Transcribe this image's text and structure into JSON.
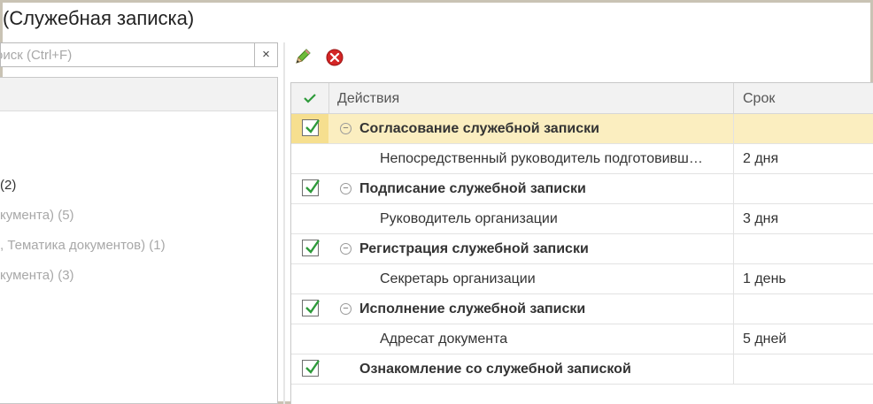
{
  "window": {
    "title": "(Служебная записка)"
  },
  "search": {
    "placeholder": "оиск (Ctrl+F)",
    "clear_label": "×"
  },
  "left_tree": {
    "lines": [
      "(2)",
      "кумента) (5)",
      ", Тематика документов) (1)",
      "кумента) (3)"
    ]
  },
  "toolbar": {
    "edit_icon": "pencil-icon",
    "delete_icon": "delete-icon"
  },
  "grid": {
    "columns": {
      "check": "check-icon",
      "actions": "Действия",
      "term": "Срок"
    },
    "rows": [
      {
        "kind": "stage",
        "checked": true,
        "label": "Согласование служебной записки",
        "term": ""
      },
      {
        "kind": "step",
        "label": "Непосредственный руководитель подготовивш…",
        "term": "2 дня"
      },
      {
        "kind": "stage",
        "checked": true,
        "label": "Подписание служебной записки",
        "term": ""
      },
      {
        "kind": "step",
        "label": "Руководитель организации",
        "term": "3 дня"
      },
      {
        "kind": "stage",
        "checked": true,
        "label": "Регистрация служебной записки",
        "term": ""
      },
      {
        "kind": "step",
        "label": "Секретарь организации",
        "term": "1 день"
      },
      {
        "kind": "stage",
        "checked": true,
        "label": "Исполнение служебной записки",
        "term": ""
      },
      {
        "kind": "step",
        "label": "Адресат документа",
        "term": "5 дней"
      },
      {
        "kind": "stage",
        "checked": true,
        "label": "Ознакомление со служебной запиской",
        "term": ""
      }
    ]
  },
  "colors": {
    "selected_row": "#fbeec0",
    "check_green": "#2e9a3a",
    "delete_red": "#d32525"
  }
}
